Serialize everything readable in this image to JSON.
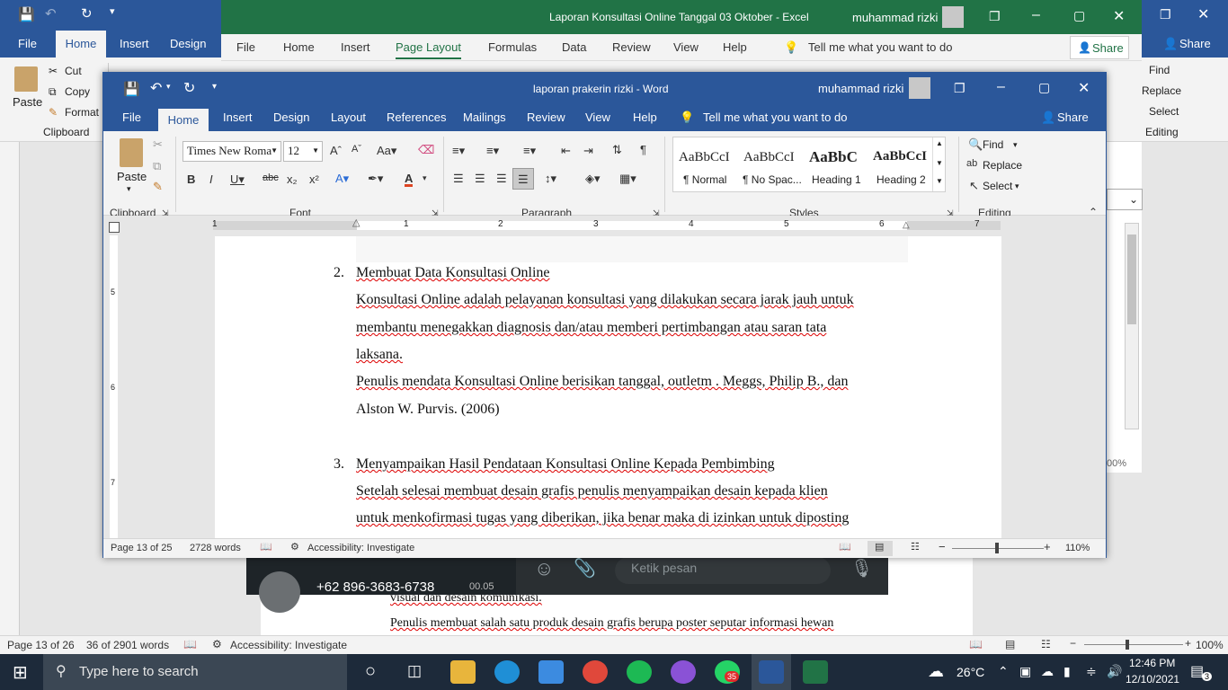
{
  "bg_word": {
    "tabs": [
      "File",
      "Home",
      "Insert",
      "Design"
    ],
    "clipboard": {
      "paste": "Paste",
      "cut": "Cut",
      "copy": "Copy",
      "format": "Format",
      "group": "Clipboard"
    },
    "right": {
      "find": "Find",
      "replace": "Replace",
      "select": "Select",
      "group": "Editing",
      "share": "Share"
    },
    "status": {
      "page": "Page 13 of 26",
      "words": "36 of 2901 words",
      "accessibility": "Accessibility: Investigate",
      "zoom": "100%"
    },
    "doc_lines": [
      "visual dan desain komunikasi.",
      "Penulis membuat salah satu produk desain grafis berupa poster seputar informasi hewan"
    ],
    "excel_zoom": "00%"
  },
  "excel": {
    "title": "Laporan Konsultasi Online Tanggal  03 Oktober  -  Excel",
    "user": "muhammad rizki",
    "tabs": [
      "File",
      "Home",
      "Insert",
      "Page Layout",
      "Formulas",
      "Data",
      "Review",
      "View",
      "Help"
    ],
    "tell_me": "Tell me what you want to do",
    "share": "Share"
  },
  "whatsapp": {
    "phone": "+62 896-3683-6738",
    "time": "00.05",
    "placeholder": "Ketik pesan"
  },
  "word": {
    "title": "laporan prakerin rizki  -  Word",
    "user": "muhammad rizki",
    "tabs": [
      "File",
      "Home",
      "Insert",
      "Design",
      "Layout",
      "References",
      "Mailings",
      "Review",
      "View",
      "Help"
    ],
    "tell_me": "Tell me what you want to do",
    "share": "Share",
    "clipboard": {
      "paste": "Paste",
      "group": "Clipboard"
    },
    "font": {
      "name": "Times New Roma",
      "size": "12",
      "group": "Font"
    },
    "paragraph_group": "Paragraph",
    "styles": [
      {
        "sample": "AaBbCcI",
        "name": "¶ Normal"
      },
      {
        "sample": "AaBbCcI",
        "name": "¶ No Spac..."
      },
      {
        "sample": "AaBbC",
        "name": "Heading 1"
      },
      {
        "sample": "AaBbCcI",
        "name": "Heading 2"
      }
    ],
    "styles_group": "Styles",
    "editing": {
      "find": "Find",
      "replace": "Replace",
      "select": "Select",
      "group": "Editing"
    },
    "ruler_numbers": [
      "1",
      "1",
      "2",
      "3",
      "4",
      "5",
      "6",
      "7"
    ],
    "vruler_numbers": [
      "5",
      "6",
      "7"
    ],
    "doc": {
      "item2_num": "2.",
      "item2_title": "Membuat Data Konsultasi Online",
      "p1_l1": "Konsultasi Online adalah pelayanan konsultasi yang dilakukan secara jarak jauh untuk",
      "p1_l2": "membantu menegakkan diagnosis dan/atau memberi pertimbangan atau saran tata",
      "p1_l3": "laksana.",
      "p2_l1": "Penulis mendata Konsultasi Online berisikan tanggal, outletm . Meggs, Philip B., dan",
      "p2_l2": "Alston W. Purvis. (2006)",
      "item3_num": "3.",
      "item3_title": "Menyampaikan Hasil Pendataan Konsultasi Online Kepada Pembimbing",
      "p3_l1": "Setelah selesai membuat desain grafis penulis menyampaikan desain kepada klien",
      "p3_l2": "untuk menkofirmasi tugas yang diberikan, jika benar maka di izinkan untuk diposting"
    },
    "status": {
      "page": "Page 13 of 25",
      "words": "2728 words",
      "accessibility": "Accessibility: Investigate",
      "zoom": "110%"
    }
  },
  "taskbar": {
    "search_placeholder": "Type here to search",
    "weather": "26°C",
    "time": "12:46 PM",
    "date": "12/10/2021",
    "notif_count": "3",
    "wa_badge": "35",
    "colors": {
      "taskbar": "#1d2a3a",
      "word": "#2b579a",
      "excel": "#217346"
    }
  }
}
